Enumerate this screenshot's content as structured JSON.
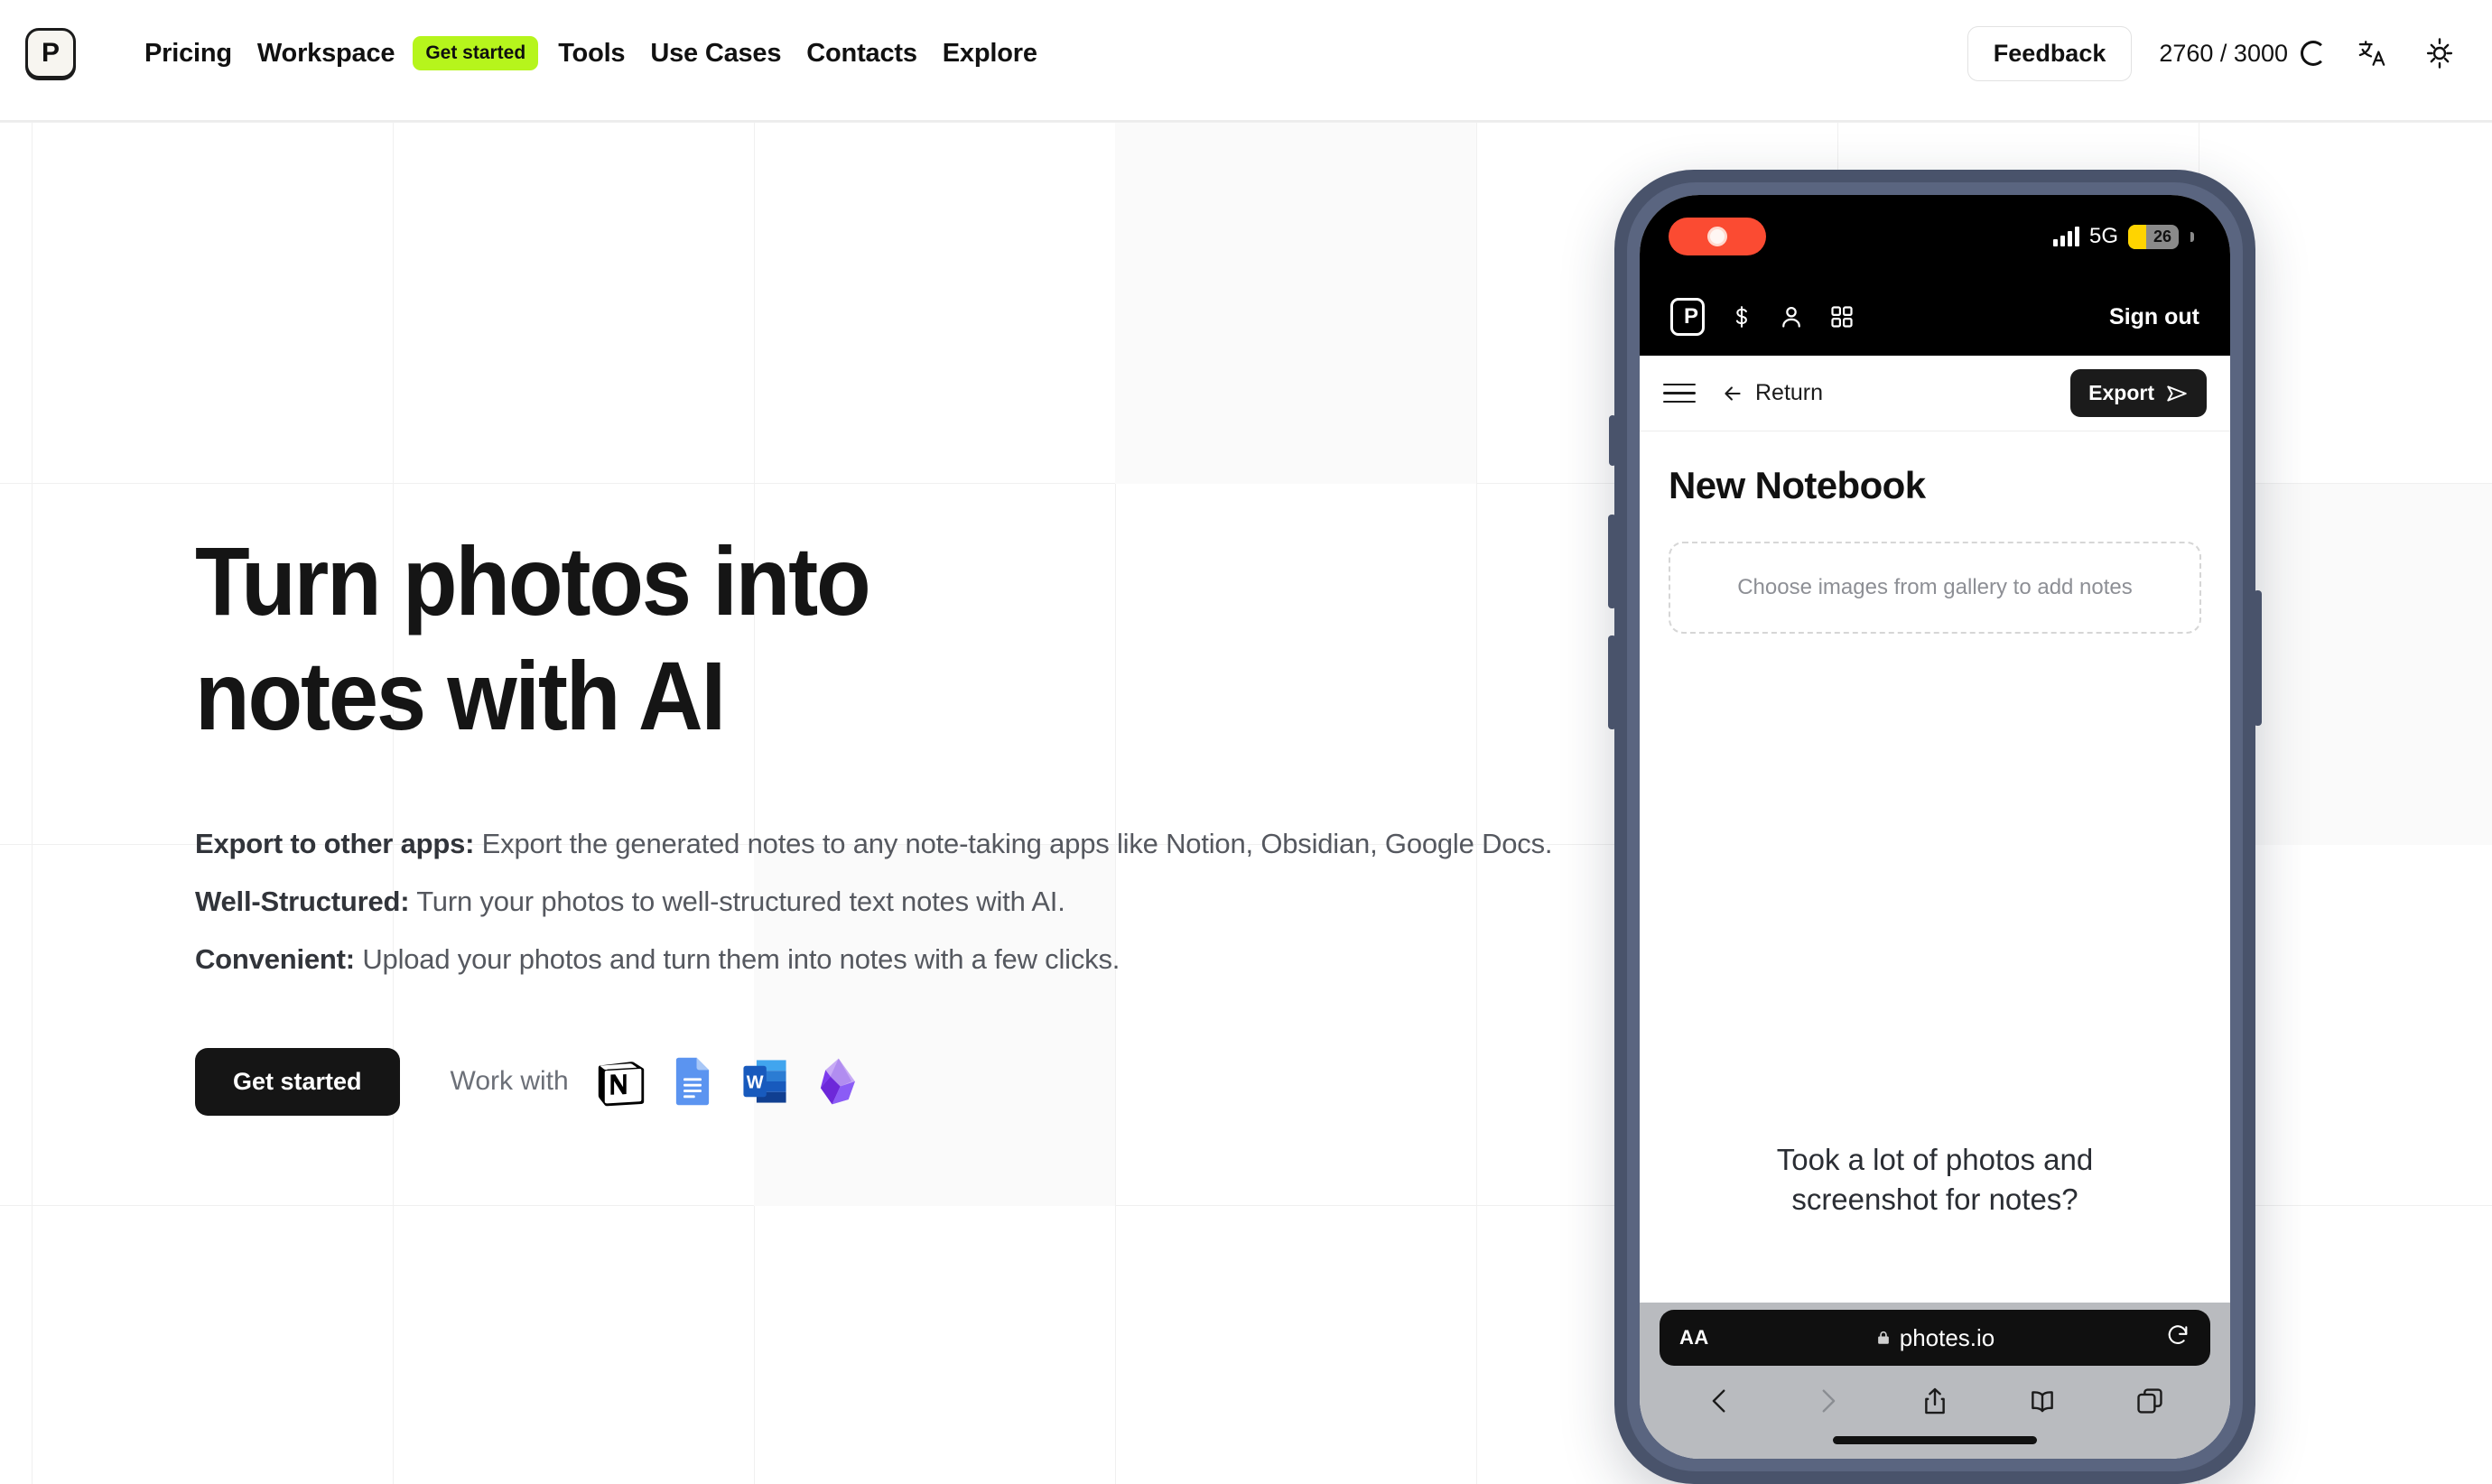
{
  "header": {
    "logo_letter": "P",
    "nav": [
      {
        "label": "Pricing",
        "name": "pricing"
      },
      {
        "label": "Workspace",
        "name": "workspace"
      },
      {
        "label": "Tools",
        "name": "tools"
      },
      {
        "label": "Use Cases",
        "name": "use-cases"
      },
      {
        "label": "Contacts",
        "name": "contacts"
      },
      {
        "label": "Explore",
        "name": "explore"
      }
    ],
    "get_started_badge": "Get started",
    "feedback_label": "Feedback",
    "quota_text": "2760 / 3000",
    "language_icon": "translate-icon",
    "theme_icon": "sun-icon",
    "accent_green": "#b6f51c"
  },
  "hero": {
    "title_line1": "Turn photos into",
    "title_line2": "notes with AI",
    "features": [
      {
        "label": "Export to other apps:",
        "text": " Export the generated notes to any note-taking apps like Notion, Obsidian, Google Docs."
      },
      {
        "label": "Well-Structured:",
        "text": " Turn your photos to well-structured text notes with AI."
      },
      {
        "label": "Convenient:",
        "text": " Upload your photos and turn them into notes with a few clicks."
      }
    ],
    "cta_label": "Get started",
    "work_with_label": "Work with",
    "app_icons": [
      {
        "name": "notion-icon",
        "title": "Notion"
      },
      {
        "name": "google-docs-icon",
        "title": "Google Docs"
      },
      {
        "name": "microsoft-word-icon",
        "title": "Microsoft Word"
      },
      {
        "name": "obsidian-icon",
        "title": "Obsidian"
      }
    ]
  },
  "phone": {
    "status_bar": {
      "recording_indicator": "screen-recording-pill",
      "network": "5G",
      "battery_level": "26"
    },
    "app_topbar": {
      "logo_letter": "P",
      "icons": [
        "dollar-icon",
        "user-icon",
        "grid-icon"
      ],
      "signout_label": "Sign out"
    },
    "app_nav": {
      "menu_icon": "hamburger-icon",
      "return_label": "Return",
      "export_label": "Export"
    },
    "content": {
      "notebook_title": "New Notebook",
      "dropzone_text": "Choose images from gallery to add notes",
      "promo_line1": "Took a lot of photos and",
      "promo_line2": "screenshot for notes?"
    },
    "safari": {
      "text_size_label": "AA",
      "url": "photes.io",
      "lock_icon": "lock-icon",
      "reload_icon": "reload-icon",
      "toolbar_icons": [
        "back-icon",
        "forward-icon",
        "share-icon",
        "bookmarks-icon",
        "tabs-icon"
      ]
    }
  }
}
